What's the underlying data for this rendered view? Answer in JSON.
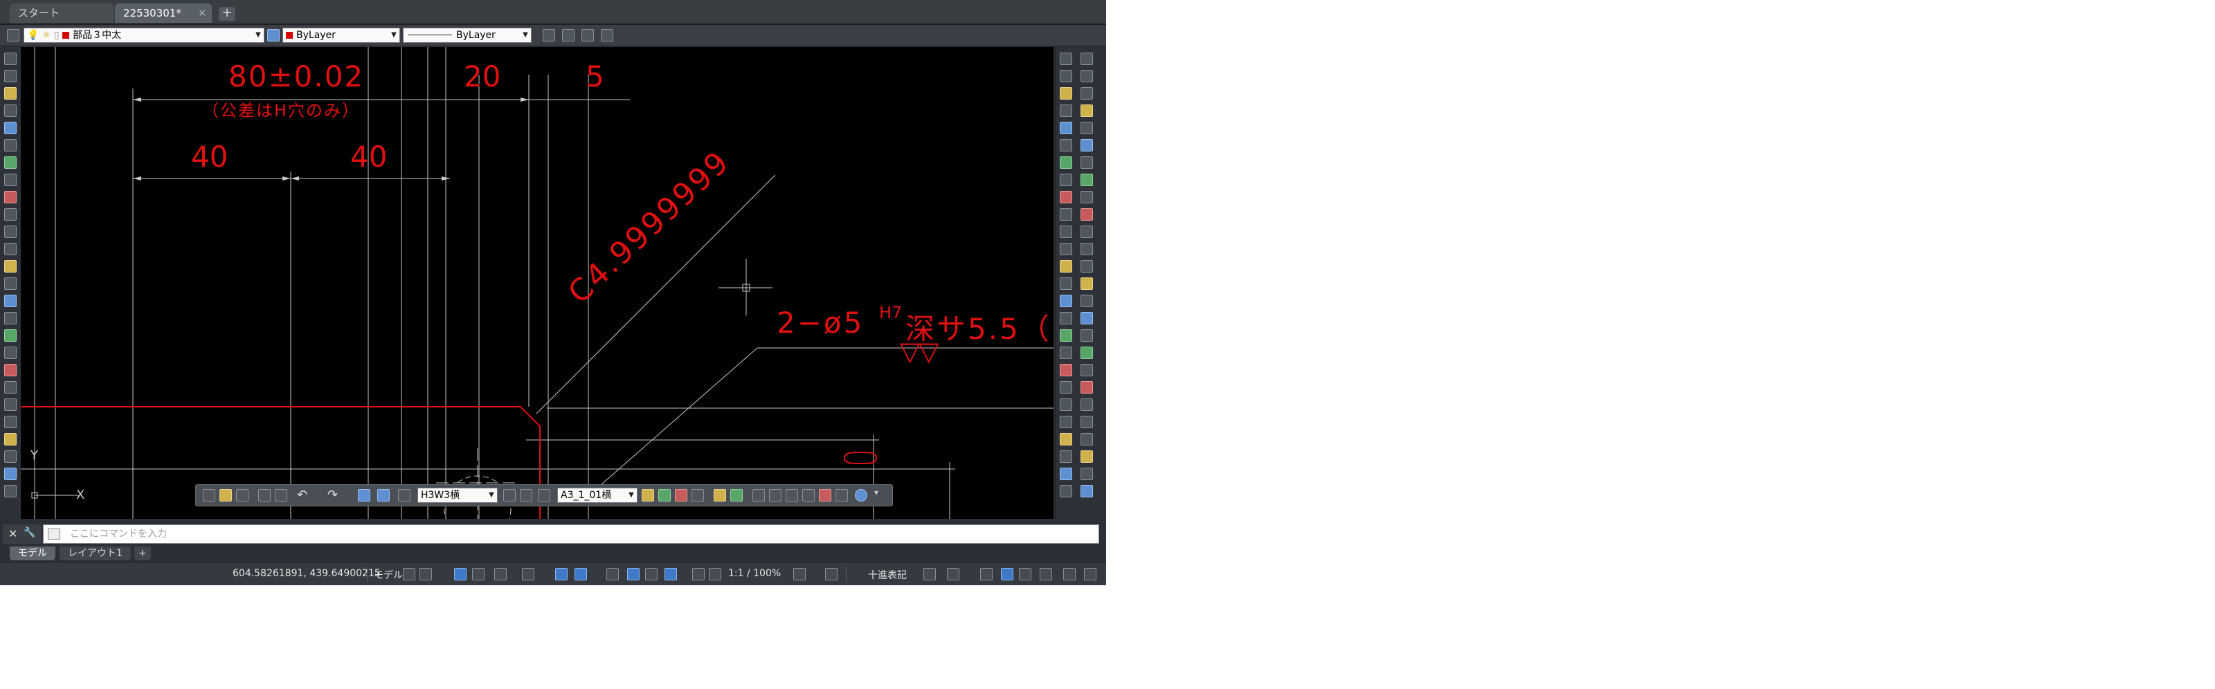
{
  "tabs": [
    {
      "label": "スタート"
    },
    {
      "label": "22530301*",
      "close": "×"
    }
  ],
  "tab_add": "+",
  "propbar": {
    "layer": "部品３中太",
    "color": "ByLayer",
    "linetype": "ByLayer",
    "layer_color": "#d60000"
  },
  "drawing": {
    "dims": [
      "80±0.02",
      "（公差はH穴のみ）",
      "20",
      "5",
      "40",
      "40"
    ],
    "chamfer": "C4.9999999",
    "hole_note": "2−ø5",
    "hole_fit": "H7",
    "hole_depth": "深サ5.5（",
    "finish": "▽▽",
    "ucs_x": "X",
    "ucs_y": "Y",
    "colors": {
      "annotation": "#e01010",
      "geometry": "#c8c8c8",
      "background": "#000000"
    }
  },
  "floatbar": {
    "combo1": "H3W3横",
    "combo2": "A3_1_01横"
  },
  "cmdline": {
    "close": "✕",
    "wrench": "🔧",
    "placeholder": "ここにコマンドを入力"
  },
  "layout_tabs": [
    {
      "label": "モデル"
    },
    {
      "label": "レイアウト1"
    }
  ],
  "layout_add": "+",
  "status": {
    "coords": "604.58261891, 439.64900215",
    "space": "モデル",
    "scale": "1:1 / 100%",
    "units": "十進表記"
  }
}
